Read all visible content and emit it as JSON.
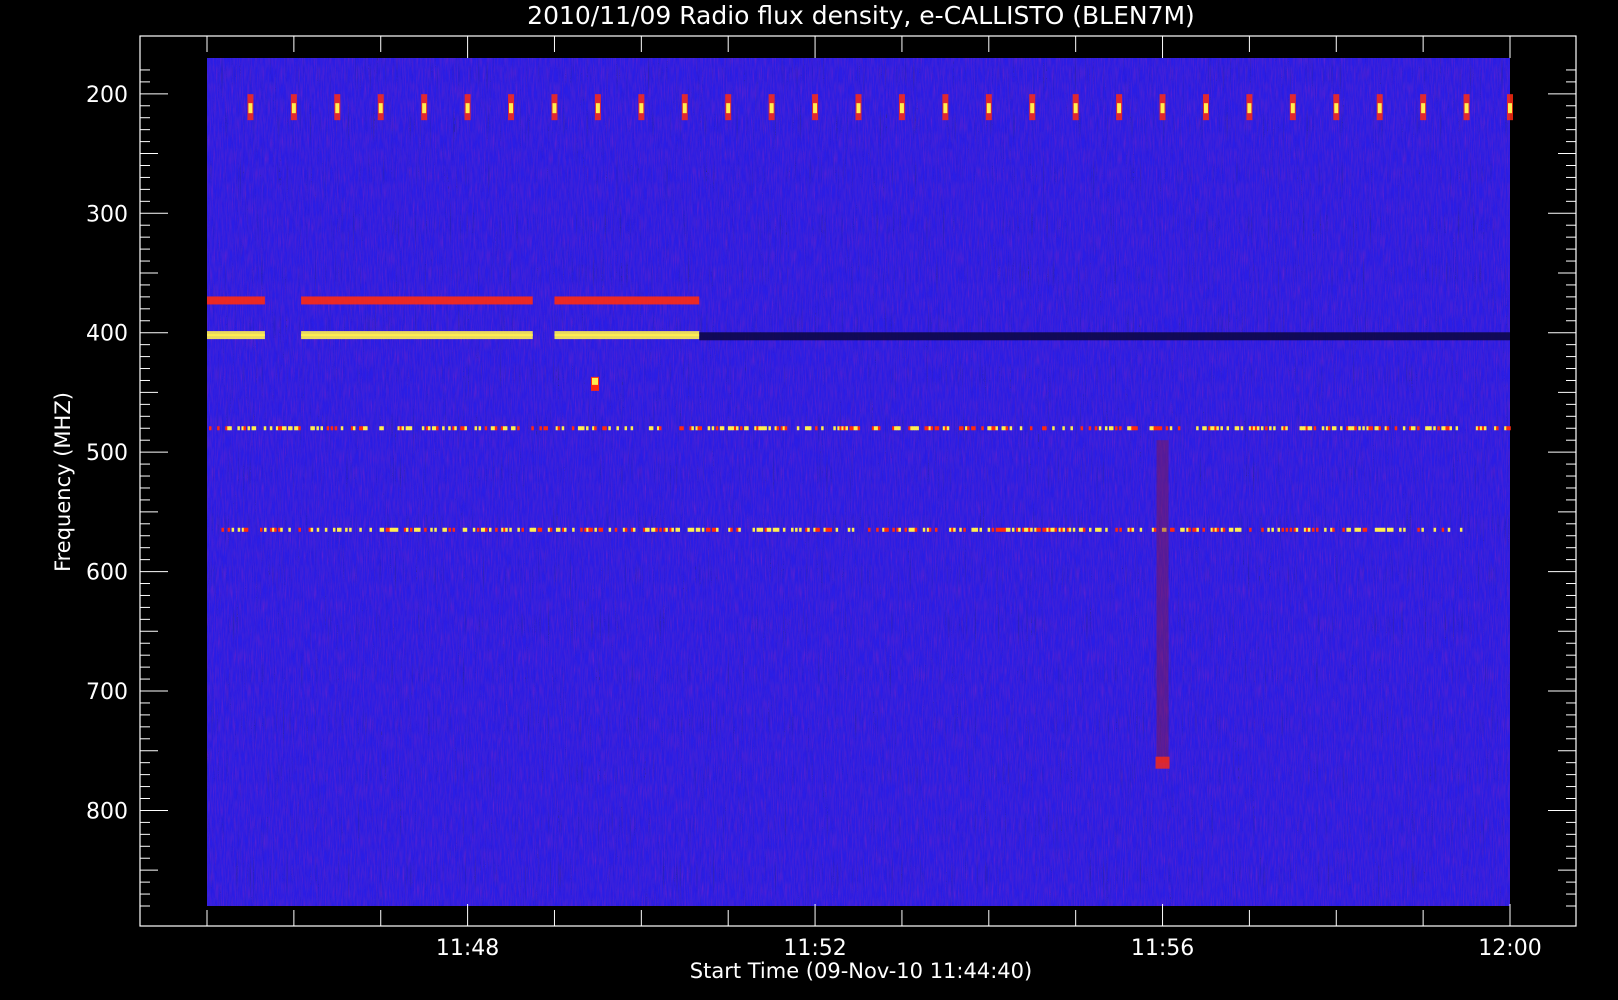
{
  "chart_data": {
    "type": "heatmap",
    "title": "2010/11/09  Radio flux density, e-CALLISTO (BLEN7M)",
    "xlabel": "Start Time (09-Nov-10 11:44:40)",
    "ylabel": "Frequency (MHZ)",
    "x_range": [
      "11:45:00",
      "12:00:00"
    ],
    "x_ticks": [
      "11:48",
      "11:52",
      "11:56",
      "12:00"
    ],
    "y_range": [
      880,
      170
    ],
    "y_ticks": [
      200,
      300,
      400,
      500,
      600,
      700,
      800
    ],
    "colormap": {
      "background": "#2a1ee6",
      "dark": "#0a0640",
      "medium": "#8a1840",
      "hot": "#ff2a10",
      "peak": "#ffee50"
    },
    "features": [
      {
        "kind": "persistent-band",
        "freq_mhz": 373,
        "t_start": "11:45:00",
        "t_end": "11:50:40",
        "gaps": [
          [
            "11:45:40",
            "11:46:05"
          ],
          [
            "11:48:45",
            "11:49:00"
          ]
        ],
        "intensity": "hot"
      },
      {
        "kind": "persistent-band",
        "freq_mhz": 402,
        "t_start": "11:45:00",
        "t_end": "11:50:40",
        "gaps": [
          [
            "11:45:40",
            "11:46:05"
          ],
          [
            "11:48:45",
            "11:49:00"
          ]
        ],
        "intensity": "peak"
      },
      {
        "kind": "persistent-band",
        "freq_mhz": 403,
        "t_start": "11:50:40",
        "t_end": "12:00:00",
        "intensity": "dark"
      },
      {
        "kind": "periodic-bursts",
        "freq_mhz": 212,
        "period_s": 30,
        "t_start": "11:45:30",
        "t_end": "12:00:00",
        "intensity": "peak"
      },
      {
        "kind": "intermittent-band",
        "freq_mhz": 480,
        "t_start": "11:45:00",
        "t_end": "12:00:00",
        "intensity": "peak"
      },
      {
        "kind": "intermittent-band",
        "freq_mhz": 565,
        "t_start": "11:45:10",
        "t_end": "11:59:30",
        "intensity": "peak"
      },
      {
        "kind": "spot",
        "time": "11:49:28",
        "freq_mhz": 442,
        "intensity": "peak"
      },
      {
        "kind": "vertical-streak",
        "time": "11:56:00",
        "freq_range": [
          490,
          760
        ],
        "intensity": "medium"
      }
    ]
  }
}
